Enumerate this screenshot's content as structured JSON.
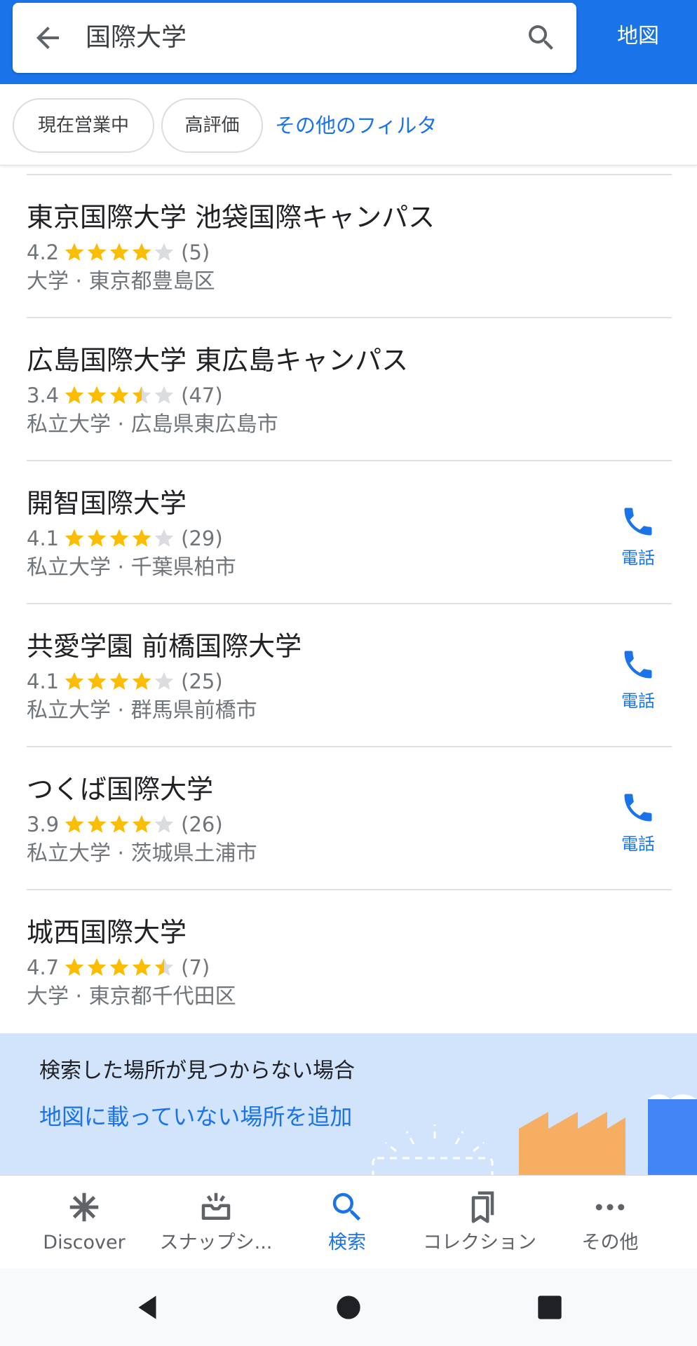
{
  "header": {
    "search_query": "国際大学",
    "map_label": "地図",
    "accent_color": "#1a73e8"
  },
  "filters": {
    "chip_open_now": "現在営業中",
    "chip_top_rated": "高評価",
    "more_filters": "その他のフィルタ"
  },
  "results": [
    {
      "title": "東京国際大学 池袋国際キャンパス",
      "rating": "4.2",
      "stars": 4.2,
      "count": "(5)",
      "desc": "大学 · 東京都豊島区",
      "call": false
    },
    {
      "title": "広島国際大学 東広島キャンパス",
      "rating": "3.4",
      "stars": 3.4,
      "count": "(47)",
      "desc": "私立大学 · 広島県東広島市",
      "call": false
    },
    {
      "title": "開智国際大学",
      "rating": "4.1",
      "stars": 4.1,
      "count": "(29)",
      "desc": "私立大学 · 千葉県柏市",
      "call": true,
      "call_label": "電話"
    },
    {
      "title": "共愛学園 前橋国際大学",
      "rating": "4.1",
      "stars": 4.1,
      "count": "(25)",
      "desc": "私立大学 · 群馬県前橋市",
      "call": true,
      "call_label": "電話"
    },
    {
      "title": "つくば国際大学",
      "rating": "3.9",
      "stars": 3.9,
      "count": "(26)",
      "desc": "私立大学 · 茨城県土浦市",
      "call": true,
      "call_label": "電話"
    },
    {
      "title": "城西国際大学",
      "rating": "4.7",
      "stars": 4.7,
      "count": "(7)",
      "desc": "大学 · 東京都千代田区",
      "call": false
    }
  ],
  "banner": {
    "text": "検索した場所が見つからない場合",
    "link": "地図に載っていない場所を追加"
  },
  "bottom_nav": {
    "discover": "Discover",
    "snapshot": "スナップシ...",
    "search": "検索",
    "collection": "コレクション",
    "more": "その他"
  },
  "colors": {
    "star_filled": "#fbbc04",
    "star_empty": "#dadce0"
  }
}
